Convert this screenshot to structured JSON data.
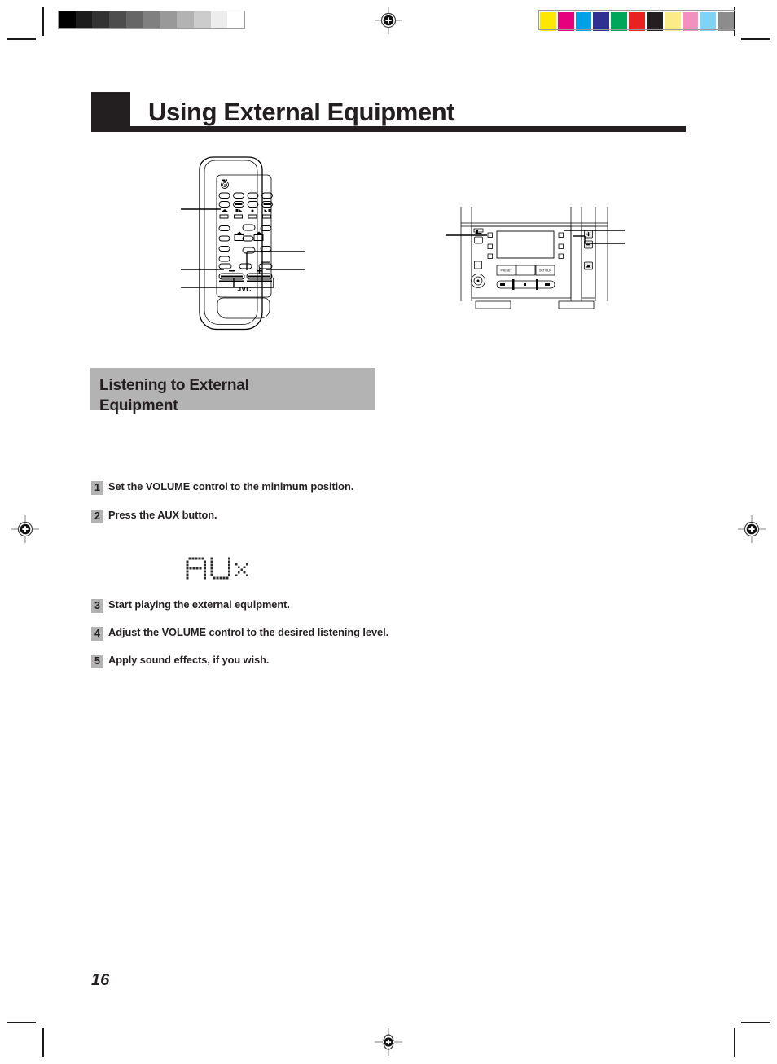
{
  "page": {
    "number": "16",
    "title": "Using External Equipment"
  },
  "section": {
    "heading_line1": "Listening to External",
    "heading_line2": "Equipment",
    "heading_bg": "#b3b3b3"
  },
  "steps": [
    {
      "num": "1",
      "text": "Set the VOLUME control to the minimum position."
    },
    {
      "num": "2",
      "text": "Press the AUX button."
    },
    {
      "num": "3",
      "text": "Start playing the external equipment."
    },
    {
      "num": "4",
      "text": "Adjust the VOLUME control to the desired listening level."
    },
    {
      "num": "5",
      "text": "Apply sound effects, if you wish."
    }
  ],
  "display": {
    "readout": "AUX",
    "style": "dot-matrix-lcd"
  },
  "illustrations": {
    "remote": {
      "brand": "JVC",
      "volume_minus": "–",
      "volume_plus": "+"
    },
    "stereo": {
      "volume_up": "+",
      "volume_down": "–",
      "eject": "▲",
      "panel_button_left": "PRESET",
      "panel_button_right": "SET/CLR"
    }
  },
  "colors": {
    "ink": "#231f20",
    "gray_panel": "#b3b3b3",
    "line": "#000000"
  },
  "print_marks": {
    "grayscale_steps": [
      "#000000",
      "#1c1c1c",
      "#333333",
      "#4d4d4d",
      "#666666",
      "#808080",
      "#999999",
      "#b3b3b3",
      "#cccccc",
      "#ededed",
      "#ffffff"
    ],
    "color_steps": [
      "#ffe800",
      "#e6007e",
      "#00a0e9",
      "#2e3192",
      "#00a65a",
      "#e8231f",
      "#231f20",
      "#fbec88",
      "#f490c0",
      "#7fd4f5",
      "#8c8c8c"
    ],
    "registration_mark": "registration-target"
  }
}
